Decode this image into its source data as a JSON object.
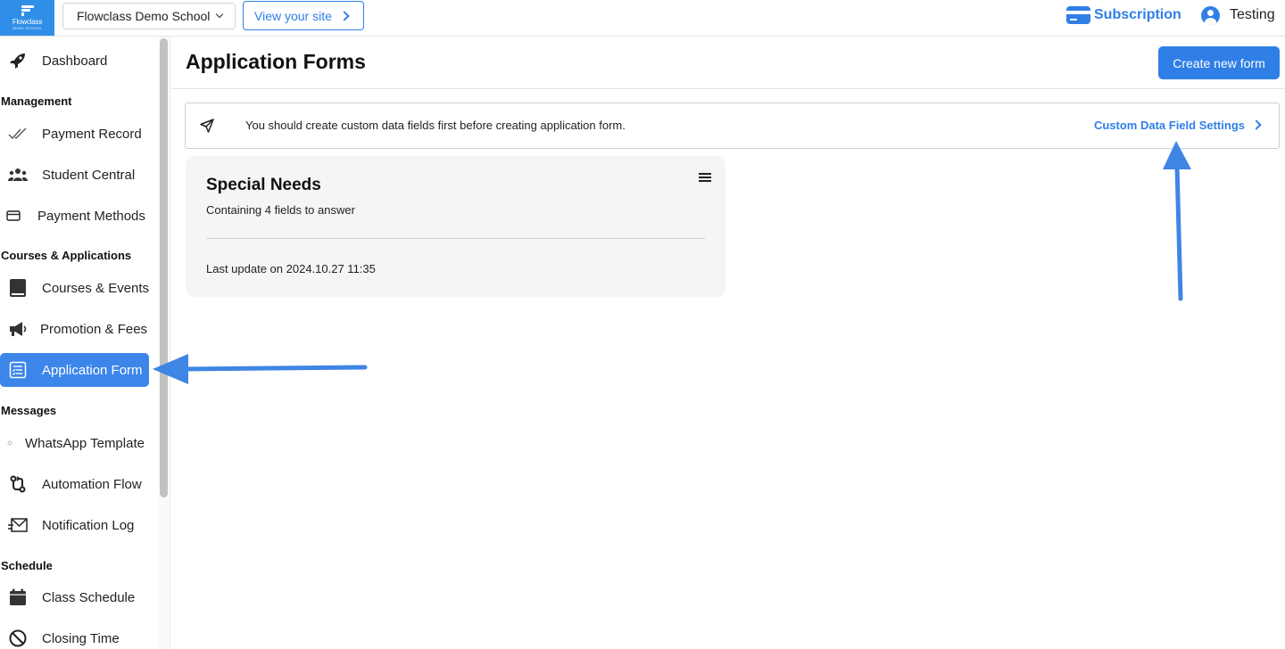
{
  "header": {
    "logo": {
      "brand": "Flowclass",
      "sub": "DEMO SCHOOL"
    },
    "school_selector": "Flowclass Demo School",
    "view_site": "View your site",
    "subscription": "Subscription",
    "user": "Testing"
  },
  "sidebar": {
    "dashboard": "Dashboard",
    "sections": {
      "management": "Management",
      "courses_applications": "Courses & Applications",
      "messages": "Messages",
      "schedule": "Schedule"
    },
    "items": {
      "payment_record": "Payment Record",
      "student_central": "Student Central",
      "payment_methods": "Payment Methods",
      "courses_events": "Courses & Events",
      "promotion_fees": "Promotion & Fees",
      "application_form": "Application Form",
      "whatsapp_template": "WhatsApp Template",
      "automation_flow": "Automation Flow",
      "notification_log": "Notification Log",
      "class_schedule": "Class Schedule",
      "closing_time": "Closing Time"
    },
    "active_item": "Application Form"
  },
  "main": {
    "title": "Application Forms",
    "create_button": "Create new form",
    "banner": {
      "message": "You should create custom data fields first before creating application form.",
      "link": "Custom Data Field Settings"
    },
    "forms": [
      {
        "name": "Special Needs",
        "description": "Containing 4 fields to answer",
        "last_update": "Last update on 2024.10.27 11:35"
      }
    ]
  },
  "colors": {
    "accent": "#2f7fe6",
    "active_nav": "#3c86ea",
    "annotation_arrow": "#3f85e4"
  }
}
